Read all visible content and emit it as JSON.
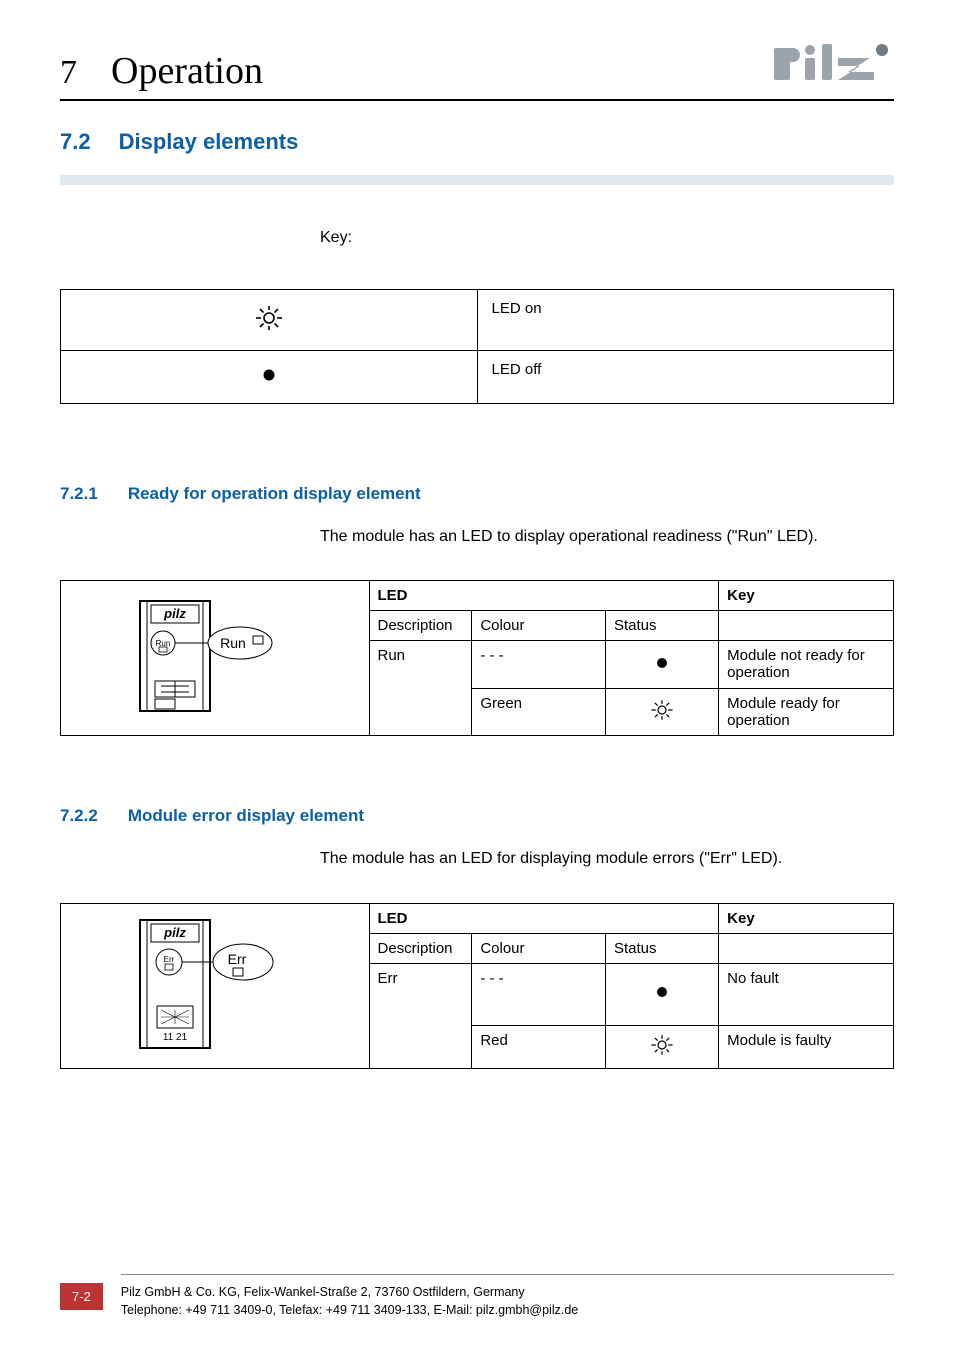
{
  "chapter": {
    "number": "7",
    "title": "Operation"
  },
  "section": {
    "number": "7.2",
    "title": "Display elements"
  },
  "key": {
    "label": "Key:",
    "rows": [
      {
        "icon": "led-on",
        "text": "LED on"
      },
      {
        "icon": "led-off",
        "text": "LED off"
      }
    ]
  },
  "subsections": [
    {
      "number": "7.2.1",
      "title": "Ready for operation display element",
      "intro": "The module has an LED to display operational readiness (\"Run\" LED).",
      "diagram": {
        "brand": "pilz",
        "chipLabel": "Run",
        "calloutLabel": "Run",
        "smallChip": "",
        "terminalLabel": ""
      },
      "table": {
        "headers": {
          "led": "LED",
          "key": "Key",
          "description": "Description",
          "colour": "Colour",
          "status": "Status"
        },
        "descValue": "Run",
        "rows": [
          {
            "colour": "- - -",
            "statusIcon": "led-off",
            "key": "Module not ready for opera­tion"
          },
          {
            "colour": "Green",
            "statusIcon": "led-on",
            "key": "Module ready for operation"
          }
        ]
      }
    },
    {
      "number": "7.2.2",
      "title": "Module error display element",
      "intro": "The module has an LED for displaying module errors (\"Err\" LED).",
      "diagram": {
        "brand": "pilz",
        "chipLabel": "Err",
        "calloutLabel": "Err",
        "smallChip": "",
        "terminalLabel": "11 21"
      },
      "table": {
        "headers": {
          "led": "LED",
          "key": "Key",
          "description": "Description",
          "colour": "Colour",
          "status": "Status"
        },
        "descValue": "Err",
        "rows": [
          {
            "colour": "- - -",
            "statusIcon": "led-off",
            "key": "No fault"
          },
          {
            "colour": "Red",
            "statusIcon": "led-on",
            "key": "Module is faulty"
          }
        ]
      }
    }
  ],
  "footer": {
    "pageNumber": "7-2",
    "line1": "Pilz GmbH & Co. KG, Felix-Wankel-Straße 2, 73760 Ostfildern, Germany",
    "line2": "Telephone: +49 711 3409-0, Telefax: +49 711 3409-133, E-Mail: pilz.gmbh@pilz.de"
  }
}
